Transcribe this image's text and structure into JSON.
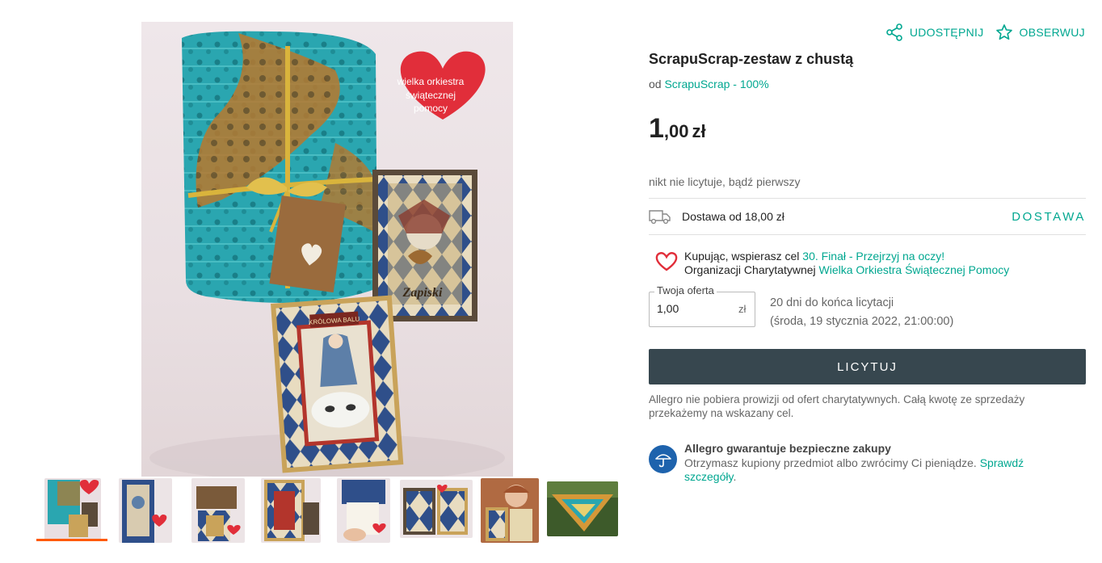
{
  "actions": {
    "share_label": "UDOSTĘPNIJ",
    "watch_label": "OBSERWUJ"
  },
  "product": {
    "title": "ScrapuScrap-zestaw z chustą",
    "seller_prefix": "od",
    "seller_link": "ScrapuScrap - 100%",
    "price_int": "1",
    "price_dec": ",00",
    "currency": "zł",
    "bids_status": "nikt nie licytuje, bądź pierwszy"
  },
  "delivery": {
    "text": "Dostawa od 18,00 zł",
    "link": "DOSTAWA"
  },
  "charity": {
    "line1_text": "Kupując, wspierasz cel",
    "line1_link": "30. Finał - Przejrzyj na oczy!",
    "line2_text": "Organizacji Charytatywnej",
    "line2_link": "Wielka Orkiestra Świątecznej Pomocy"
  },
  "bid": {
    "legend": "Twoja oferta",
    "value": "1,00",
    "unit": "zł",
    "time_left": "20 dni do końca licytacji",
    "end_date": "(środa, 19 stycznia 2022, 21:00:00)",
    "button_label": "LICYTUJ"
  },
  "note": "Allegro nie pobiera prowizji od ofert charytatywnych. Całą kwotę ze sprzedaży przekażemy na wskazany cel.",
  "guarantee": {
    "title": "Allegro gwarantuje bezpieczne zakupy",
    "text": "Otrzymasz kupiony przedmiot albo zwrócimy Ci pieniądze.",
    "link": "Sprawdź szczegóły",
    "trailing": "."
  },
  "photo": {
    "heart_line1": "wielka orkiestra",
    "heart_line2": "świątecznej",
    "heart_line3": "pomocy",
    "card_title": "Zapiski",
    "card_banner": "KRÓLOWA BALU"
  },
  "colors": {
    "accent": "#00a790",
    "button": "#37474f",
    "active_thumb": "#ff5a00",
    "guarantee_badge": "#1e63ad",
    "heart": "#e12e3a"
  },
  "thumbnails": [
    {
      "name": "thumb-1",
      "active": true
    },
    {
      "name": "thumb-2",
      "active": false
    },
    {
      "name": "thumb-3",
      "active": false
    },
    {
      "name": "thumb-4",
      "active": false
    },
    {
      "name": "thumb-5",
      "active": false
    },
    {
      "name": "thumb-6",
      "active": false
    },
    {
      "name": "thumb-7",
      "active": false
    },
    {
      "name": "thumb-8",
      "active": false
    }
  ]
}
